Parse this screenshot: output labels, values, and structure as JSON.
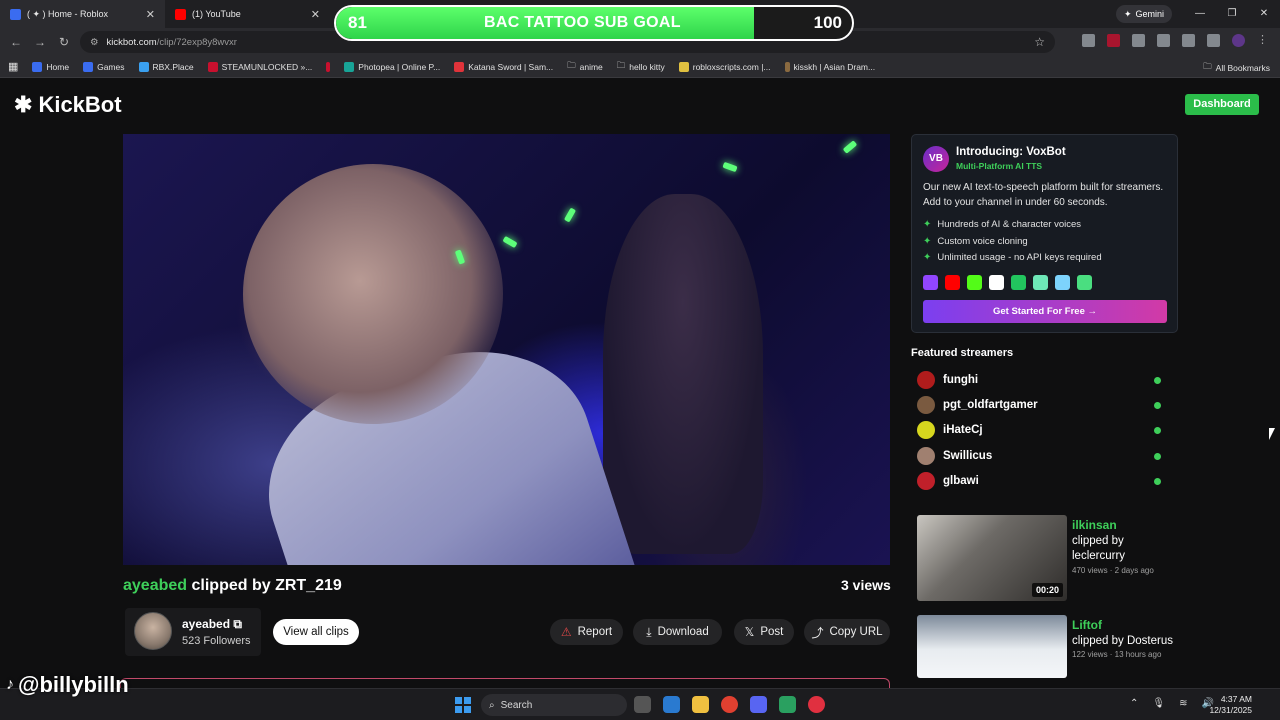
{
  "browser": {
    "tabs": [
      {
        "title": "( ✦ ) Home - Roblox",
        "color": "#3a6cf0"
      },
      {
        "title": "(1) YouTube",
        "color": "#ff0000"
      }
    ],
    "gemini_label": "Gemini",
    "url_host": "kickbot.com",
    "url_path": "/clip/72exp8y8wvxr",
    "bookmarks": [
      {
        "label": "Home",
        "color": "#3a6cf0"
      },
      {
        "label": "Games",
        "color": "#3a6cf0"
      },
      {
        "label": "RBX.Place",
        "color": "#3aa0f0"
      },
      {
        "label": "STEAMUNLOCKED »...",
        "color": "#c8102e"
      },
      {
        "label": "",
        "color": "#c8102e"
      },
      {
        "label": "Photopea | Online P...",
        "color": "#18a497"
      },
      {
        "label": "Katana Sword | Sam...",
        "color": "#e0333a"
      },
      {
        "label": "anime",
        "color": "#888888"
      },
      {
        "label": "hello kitty",
        "color": "#888888"
      },
      {
        "label": "robloxscripts.com |...",
        "color": "#e0c040"
      },
      {
        "label": "kisskh | Asian Dram...",
        "color": "#8a6a40"
      }
    ],
    "all_bookmarks": "All Bookmarks"
  },
  "goal_overlay": {
    "current": "81",
    "title": "BAC TATTOO SUB GOAL",
    "target": "100",
    "progress": 0.81
  },
  "site": {
    "logo": "KickBot",
    "dashboard": "Dashboard"
  },
  "clip": {
    "channel": "ayeabed",
    "clipped_by": "clipped by ZRT_219",
    "views": "3 views",
    "creator_name": "ayeabed",
    "followers": "523 Followers",
    "view_all": "View all clips",
    "actions": {
      "report": "Report",
      "download": "Download",
      "post": "Post",
      "copy_url": "Copy URL"
    }
  },
  "voxbot": {
    "logo_text": "VB",
    "title": "Introducing: VoxBot",
    "subtitle": "Multi-Platform AI TTS",
    "description": "Our new AI text-to-speech platform built for streamers. Add to your channel in under 60 seconds.",
    "features": [
      "Hundreds of AI & character voices",
      "Custom voice cloning",
      "Unlimited usage - no API keys required"
    ],
    "platform_colors": [
      "#9146ff",
      "#ff0000",
      "#53fc18",
      "#ffffff",
      "#22c55e",
      "#6ee7b7",
      "#7dd3fc",
      "#4ade80"
    ],
    "cta": "Get Started For Free →"
  },
  "featured": {
    "heading": "Featured streamers",
    "streamers": [
      {
        "name": "funghi",
        "color": "#b01c1c"
      },
      {
        "name": "pgt_oldfartgamer",
        "color": "#7a5a40"
      },
      {
        "name": "iHateCj",
        "color": "#d6d61e"
      },
      {
        "name": "Swillicus",
        "color": "#a08070"
      },
      {
        "name": "glbawi",
        "color": "#c0202a"
      }
    ]
  },
  "related_clips": [
    {
      "streamer": "ilkinsan",
      "by": "clipped by leclercurry",
      "meta": "470 views · 2 days ago",
      "duration": "00:20"
    },
    {
      "streamer": "Liftof",
      "by": "clipped by Dosterus",
      "meta": "122 views · 13 hours ago",
      "duration": ""
    }
  ],
  "watermark": "@billybilln",
  "taskbar": {
    "search_placeholder": "Search",
    "time": "4:37 AM",
    "date": "12/31/2025"
  }
}
